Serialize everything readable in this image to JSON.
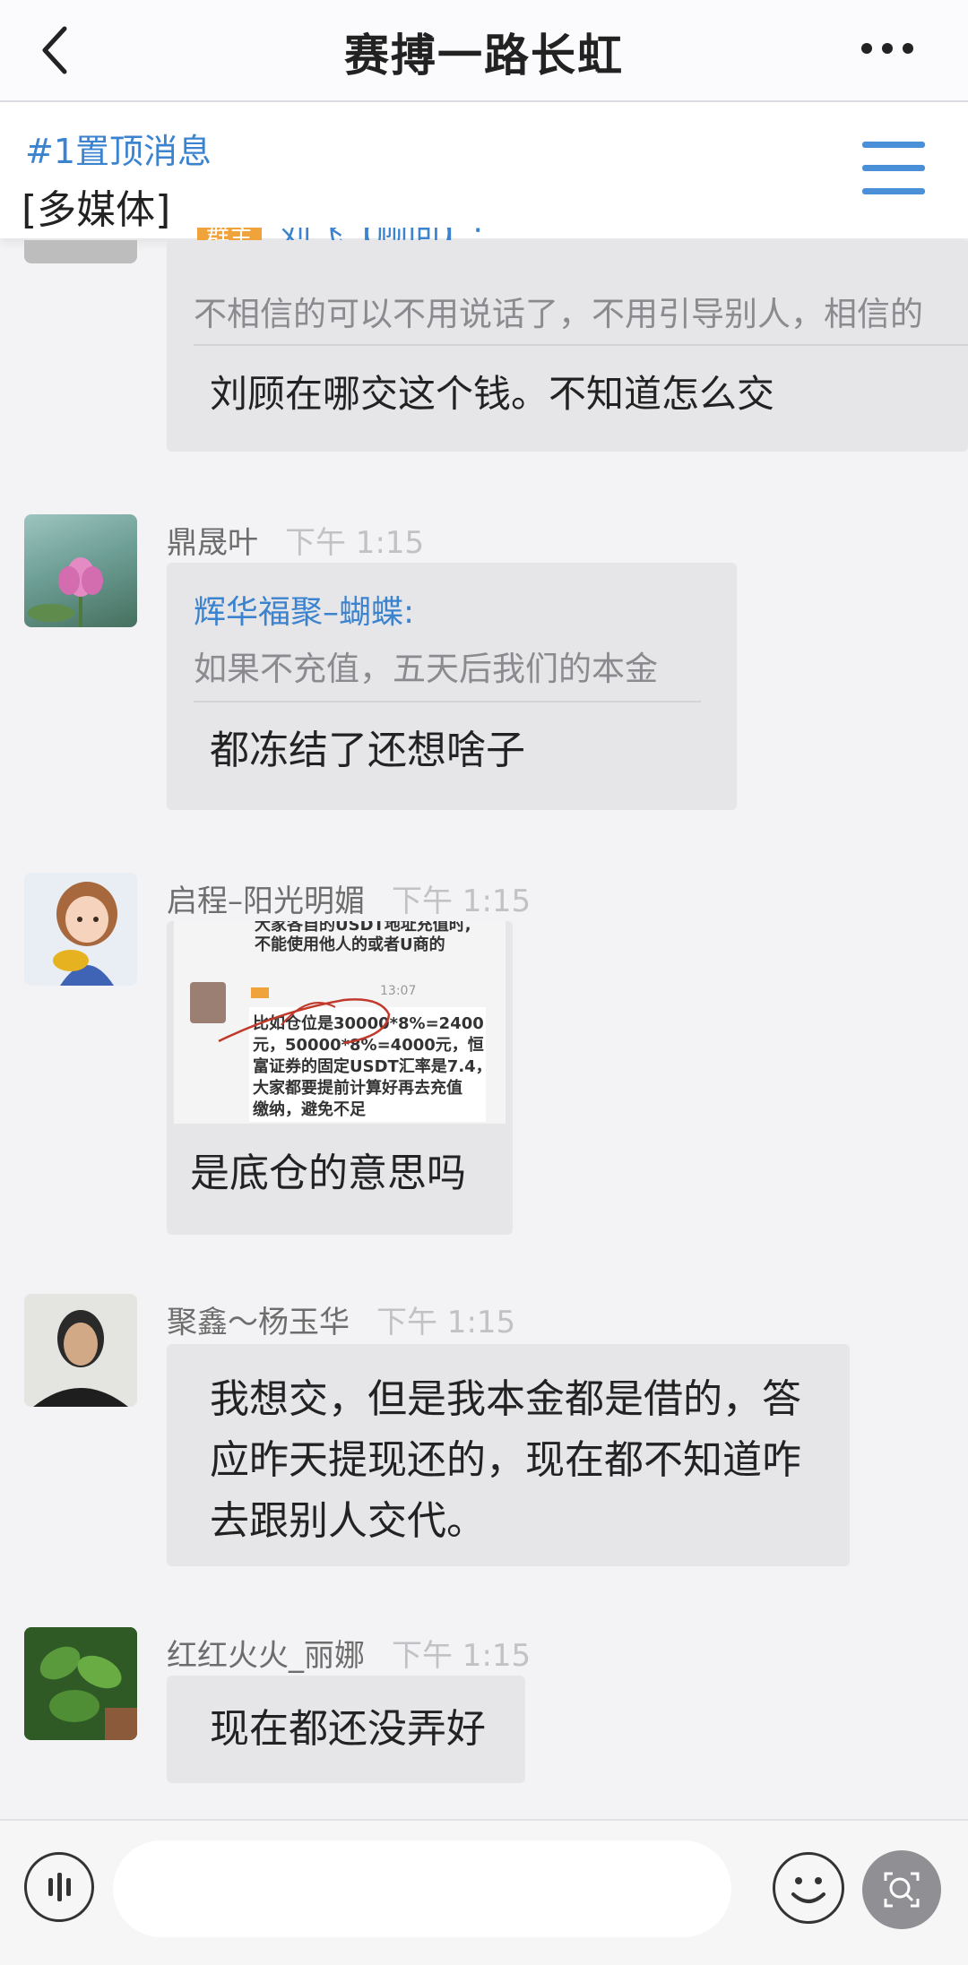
{
  "header": {
    "title": "赛搏一路长虹"
  },
  "pinned": {
    "title": "#1置顶消息",
    "subtitle": "[多媒体]"
  },
  "messages": [
    {
      "quote_sender_badge": "群主",
      "quote_sender": "刘飞【顾问】:",
      "quote_text": "不相信的可以不用说话了，不用引导别人，相信的",
      "text": "刘顾在哪交这个钱。不知道怎么交"
    },
    {
      "sender": "鼎晟叶",
      "time": "下午 1:15",
      "quote_sender": "辉华福聚–蝴蝶:",
      "quote_text": "如果不充值，五天后我们的本金",
      "text": "都冻结了还想啥子"
    },
    {
      "sender": "启程–阳光明媚",
      "time": "下午 1:15",
      "image_lines": [
        "大家各自的USDT地址充值时,",
        "不能使用他人的或者U商的",
        "比如仓位是30000*8%=2400",
        "元，50000*8%=4000元，恒",
        "富证券的固定USDT汇率是7.4，",
        "大家都要提前计算好再去充值",
        "缴纳，避免不足"
      ],
      "image_header_time": "13:07",
      "text": "是底仓的意思吗"
    },
    {
      "sender": "聚鑫～杨玉华",
      "time": "下午 1:15",
      "text_lines": [
        "我想交，但是我本金都是借的，答",
        "应昨天提现还的，现在都不知道咋",
        "去跟别人交代。"
      ]
    },
    {
      "sender": "红红火火_丽娜",
      "time": "下午 1:15",
      "text": "现在都还没弄好"
    }
  ],
  "icons": {
    "back": "back-chevron-icon",
    "more": "more-dots-icon",
    "menu": "hamburger-menu-icon",
    "voice": "voice-input-icon",
    "emoji": "emoji-icon",
    "search": "image-search-icon"
  },
  "colors": {
    "accent": "#3c83cf",
    "bubble": "#e6e6e9",
    "background": "#f3f3f5"
  }
}
